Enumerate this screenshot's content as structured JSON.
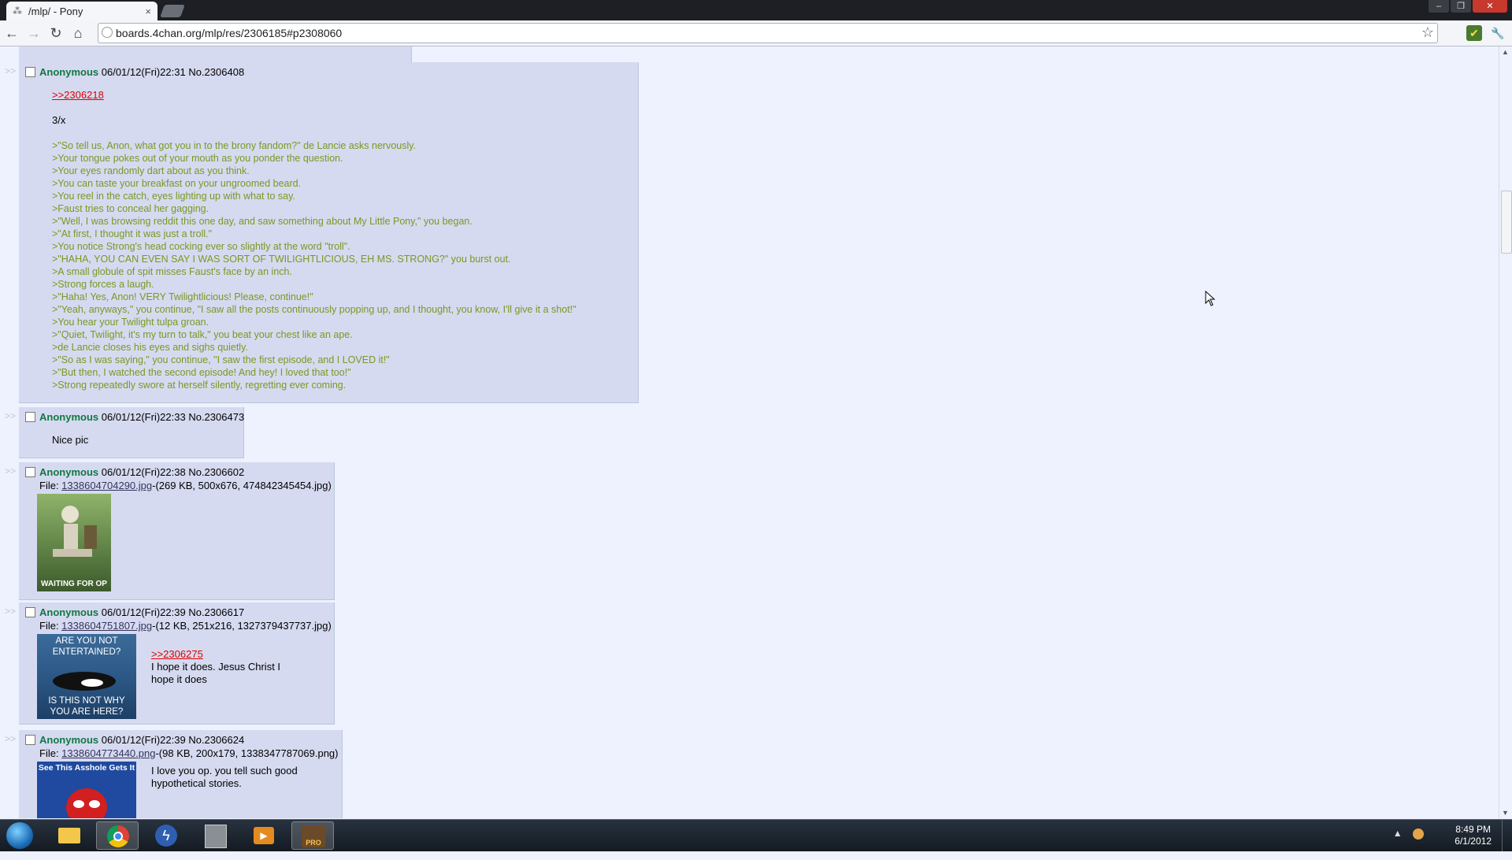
{
  "browser": {
    "tab_title": "/mlp/ - Pony",
    "tab_close": "×",
    "url": "boards.4chan.org/mlp/res/2306185#p2308060",
    "window_buttons": [
      "–",
      "❐",
      "✕"
    ]
  },
  "posts": [
    {
      "name": "Anonymous",
      "datetime": "06/01/12(Fri)22:31",
      "number": "No.2306408",
      "quotelink": ">>2306218",
      "intro": "3/x",
      "lines": [
        ">\"So tell us, Anon, what got you in to the brony fandom?\" de Lancie asks nervously.",
        ">Your tongue pokes out of your mouth as you ponder the question.",
        ">Your eyes randomly dart about as you think.",
        ">You can taste your breakfast on your ungroomed beard.",
        ">You reel in the catch, eyes lighting up with what to say.",
        ">Faust tries to conceal her gagging.",
        ">\"Well, I was browsing reddit this one day, and saw something about My Little Pony,\" you began.",
        ">\"At first, I thought it was just a troll.\"",
        ">You notice Strong's head cocking ever so slightly at the word \"troll\".",
        ">\"HAHA, YOU CAN EVEN SAY I WAS SORT OF TWILIGHTLICIOUS, EH MS. STRONG?\" you burst out.",
        ">A small globule of spit misses Faust's face by an inch.",
        ">Strong forces a laugh.",
        ">\"Haha! Yes, Anon! VERY Twilightlicious! Please, continue!\"",
        ">\"Yeah, anyways,\" you continue, \"I saw all the posts continuously popping up, and I thought, you know, I'll give it a shot!\"",
        ">You hear your Twilight tulpa groan.",
        ">\"Quiet, Twilight, it's my turn to talk,\" you beat your chest like an ape.",
        ">de Lancie closes his eyes and sighs quietly.",
        ">\"So as I was saying,\" you continue, \"I saw the first episode, and I LOVED it!\"",
        ">\"But then, I watched the second episode! And hey! I loved that too!\"",
        ">Strong repeatedly swore at herself silently, regretting ever coming."
      ]
    },
    {
      "name": "Anonymous",
      "datetime": "06/01/12(Fri)22:33",
      "number": "No.2306473",
      "text": "Nice pic"
    },
    {
      "name": "Anonymous",
      "datetime": "06/01/12(Fri)22:38",
      "number": "No.2306602",
      "file_prefix": "File: ",
      "file_name": "1338604704290.jpg",
      "file_info": "-(269 KB, 500x676, 474842345454.jpg)",
      "image_caption": "WAITING FOR OP"
    },
    {
      "name": "Anonymous",
      "datetime": "06/01/12(Fri)22:39",
      "number": "No.2306617",
      "file_prefix": "File: ",
      "file_name": "1338604751807.jpg",
      "file_info": "-(12 KB, 251x216, 1327379437737.jpg)",
      "image_top": "ARE YOU NOT ENTERTAINED?",
      "image_bottom": "IS THIS NOT WHY YOU ARE HERE?",
      "quotelink": ">>2306275",
      "text_lines": [
        "I hope it does. Jesus Christ I",
        "hope it does"
      ]
    },
    {
      "name": "Anonymous",
      "datetime": "06/01/12(Fri)22:39",
      "number": "No.2306624",
      "file_prefix": "File: ",
      "file_name": "1338604773440.png",
      "file_info": "-(98 KB, 200x179, 1338347787069.png)",
      "image_top": "See This Asshole Gets It",
      "text_lines": [
        "I love you op. you tell such good",
        "hypothetical stories."
      ]
    }
  ],
  "taskbar": {
    "time": "8:49 PM",
    "date": "6/1/2012",
    "tray_arrow": "▲"
  }
}
